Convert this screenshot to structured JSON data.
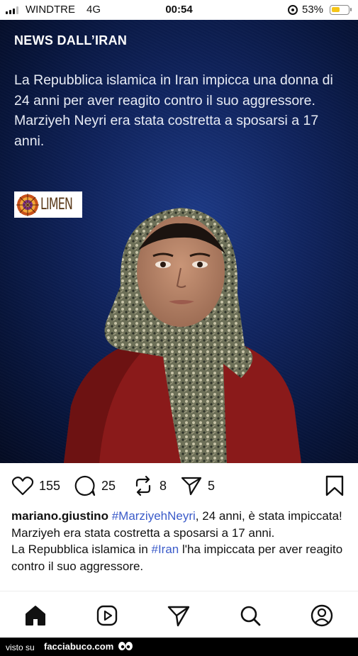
{
  "status_bar": {
    "carrier": "WINDTRE",
    "network": "4G",
    "time": "00:54",
    "battery_percent_label": "53%",
    "battery_level": 0.53
  },
  "post_image": {
    "headline": "NEWS DALL’IRAN",
    "body_lines": [
      "La Repubblica islamica in Iran impicca una donna di 24 anni per aver reagito contro il suo aggressore.",
      "Marziyeh Neyri era stata costretta a sposarsi a 17 anni."
    ],
    "logo_text": "LIMEN"
  },
  "actions": {
    "likes": "155",
    "comments": "25",
    "reposts": "8",
    "shares": "5"
  },
  "caption": {
    "username": "mariano.giustino",
    "hashtag1": "#MarziyehNeyri",
    "part1": ", 24 anni, è stata impiccata!",
    "line2": "Marziyeh era stata costretta a sposarsi a 17 anni.",
    "part3_pre": "La Repubblica islamica in ",
    "hashtag2": "#Iran",
    "part3_post": " l'ha impiccata per aver reagito contro il suo aggressore."
  },
  "bottom_nav": [
    "home-icon",
    "reels-icon",
    "send-icon",
    "search-icon",
    "profile-icon"
  ],
  "watermark": {
    "prefix": "visto su",
    "site": "facciabuco.com"
  },
  "colors": {
    "hashtag": "#3b5bc9",
    "battery": "#f5c518",
    "hero_bg": "#10245e"
  }
}
